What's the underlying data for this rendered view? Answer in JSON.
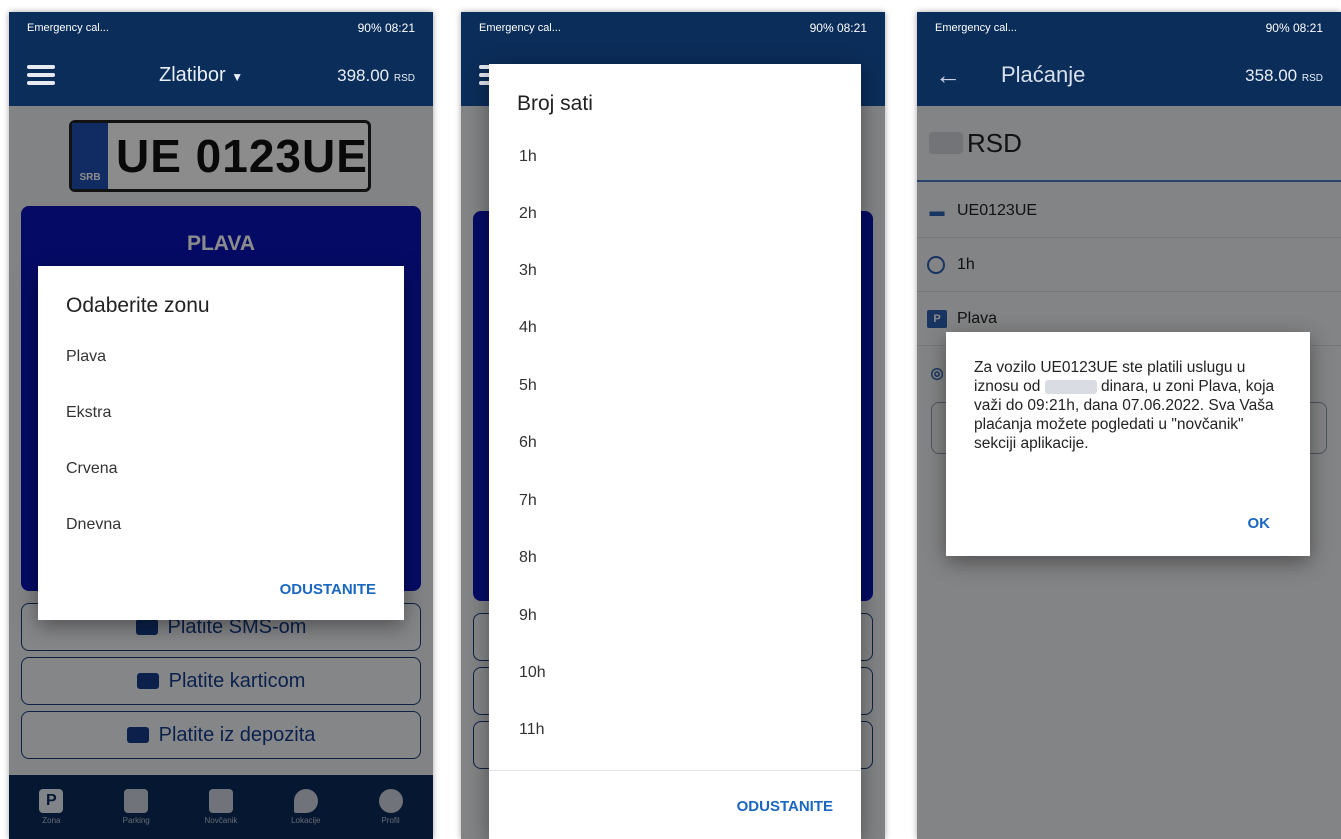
{
  "status_bar": {
    "left": "Emergency cal...",
    "right": "90%  08:21"
  },
  "screen1": {
    "city": "Zlatibor",
    "balance": "398.00",
    "currency": "RSD",
    "plate_country": "SRB",
    "plate_number": "UE 0123UE",
    "zone_title": "PLAVA",
    "pay_buttons": [
      "Platite SMS-om",
      "Platite karticom",
      "Platite iz depozita"
    ],
    "nav": [
      "Zona",
      "Parking",
      "Novčanik",
      "Lokacije",
      "Profil"
    ],
    "dialog": {
      "title": "Odaberite zonu",
      "options": [
        "Plava",
        "Ekstra",
        "Crvena",
        "Dnevna"
      ],
      "cancel": "ODUSTANITE"
    }
  },
  "screen2": {
    "dialog": {
      "title": "Broj sati",
      "options": [
        "1h",
        "2h",
        "3h",
        "4h",
        "5h",
        "6h",
        "7h",
        "8h",
        "9h",
        "10h",
        "11h"
      ],
      "cancel": "ODUSTANITE"
    }
  },
  "screen3": {
    "title": "Plaćanje",
    "balance": "358.00",
    "currency": "RSD",
    "amount_currency": "RSD",
    "rows": [
      "UE0123UE",
      "1h",
      "Plava"
    ],
    "dialog": {
      "message_1": "Za vozilo UE0123UE ste platili uslugu u iznosu od",
      "message_2": "dinara, u zoni Plava, koja važi do 09:21h, dana 07.06.2022. Sva Vaša plaćanja možete pogledati u \"novčanik\" sekciji aplikacije.",
      "ok": "OK"
    }
  },
  "colors": {
    "header": "#0b2d59",
    "zone": "#0a14b8",
    "accent": "#1a67c2"
  }
}
